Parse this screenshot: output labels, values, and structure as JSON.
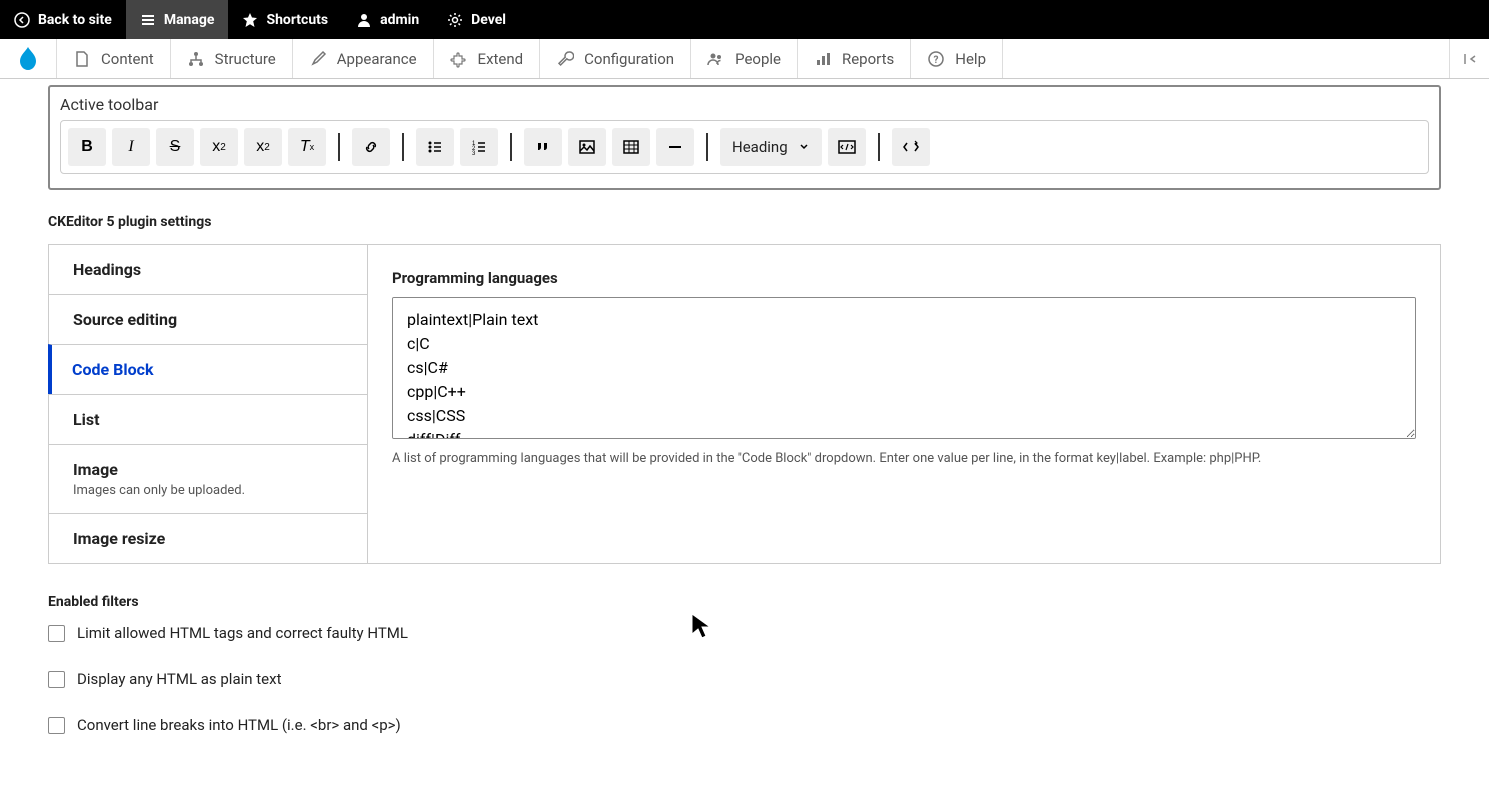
{
  "topbar": {
    "back": "Back to site",
    "manage": "Manage",
    "shortcuts": "Shortcuts",
    "admin": "admin",
    "devel": "Devel"
  },
  "nav": {
    "content": "Content",
    "structure": "Structure",
    "appearance": "Appearance",
    "extend": "Extend",
    "configuration": "Configuration",
    "people": "People",
    "reports": "Reports",
    "help": "Help"
  },
  "toolbar": {
    "label": "Active toolbar",
    "heading": "Heading"
  },
  "plugin_settings_heading": "CKEditor 5 plugin settings",
  "vtabs": {
    "headings": "Headings",
    "source": "Source editing",
    "code": "Code Block",
    "list": "List",
    "image": "Image",
    "image_desc": "Images can only be uploaded.",
    "resize": "Image resize"
  },
  "panel": {
    "label": "Programming languages",
    "value": "plaintext|Plain text\nc|C\ncs|C#\ncpp|C++\ncss|CSS\ndiff|Diff",
    "desc": "A list of programming languages that will be provided in the \"Code Block\" dropdown. Enter one value per line, in the format key|label. Example: php|PHP."
  },
  "filters": {
    "heading": "Enabled filters",
    "limit": "Limit allowed HTML tags and correct faulty HTML",
    "plain": "Display any HTML as plain text",
    "breaks": "Convert line breaks into HTML (i.e. <br> and <p>)"
  }
}
